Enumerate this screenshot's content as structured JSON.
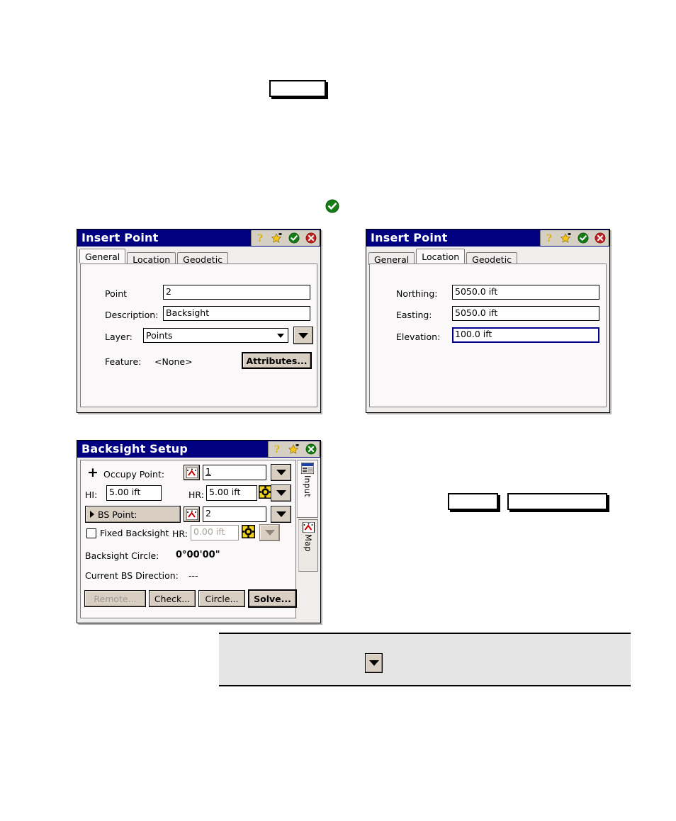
{
  "page": {
    "background": "#ffffff",
    "title_bar_color": "#000080",
    "button_face_color": "#d8cec2",
    "accent_green": "#1a8a1a",
    "accent_red": "#cc2020",
    "focus_blue": "#00008b"
  },
  "top_placeholder_box": {
    "name": "empty-outline-box",
    "label": ""
  },
  "standalone_check": {
    "name": "ok-check-icon",
    "color": "#1a8a1a"
  },
  "insert_point_general": {
    "title": "Insert Point",
    "title_icons": [
      "help-icon",
      "favorites-star-icon",
      "ok-check-icon",
      "close-x-icon"
    ],
    "tabs": [
      {
        "label": "General",
        "active": true
      },
      {
        "label": "Location",
        "active": false
      },
      {
        "label": "Geodetic",
        "active": false
      }
    ],
    "fields": [
      {
        "label": "Point",
        "value": "2"
      },
      {
        "label": "Description:",
        "value": "Backsight"
      }
    ],
    "layer": {
      "label": "Layer:",
      "value": "Points"
    },
    "feature": {
      "label": "Feature:",
      "value": "<None>"
    },
    "attributes_button": "Attributes..."
  },
  "insert_point_location": {
    "title": "Insert Point",
    "title_icons": [
      "help-icon",
      "favorites-star-icon",
      "ok-check-icon",
      "close-x-icon"
    ],
    "tabs": [
      {
        "label": "General",
        "active": false
      },
      {
        "label": "Location",
        "active": true
      },
      {
        "label": "Geodetic",
        "active": false
      }
    ],
    "fields": [
      {
        "label": "Northing:",
        "value": "5050.0 ift",
        "focused": false
      },
      {
        "label": "Easting:",
        "value": "5050.0 ift",
        "focused": false
      },
      {
        "label": "Elevation:",
        "value": "100.0 ift",
        "focused": true
      }
    ]
  },
  "backsight_setup": {
    "title": "Backsight Setup",
    "title_icons": [
      "help-icon",
      "favorites-star-icon",
      "close-green-x-icon"
    ],
    "occupy_point": {
      "label": "Occupy Point:",
      "value": "1",
      "icon": "point-pick-icon",
      "dropdown": "chevron-down-icon"
    },
    "hi": {
      "label": "HI:",
      "value": "5.00 ift"
    },
    "hr": {
      "label": "HR:",
      "value": "5.00 ift",
      "icon": "target-prism-icon",
      "dropdown": "chevron-down-icon"
    },
    "bs_point": {
      "label": "BS Point:",
      "value": "2",
      "icon": "point-pick-icon",
      "dropdown": "chevron-down-icon"
    },
    "fixed_backsight": {
      "label": "Fixed Backsight",
      "checked": false,
      "hr_label": "HR:",
      "hr_value": "0.00 ift",
      "disabled": true,
      "icon": "target-prism-icon",
      "dropdown": "chevron-down-icon"
    },
    "backsight_circle": {
      "label": "Backsight Circle:",
      "value": "0°00'00\""
    },
    "current_bs_direction": {
      "label": "Current BS Direction:",
      "value": "---"
    },
    "buttons": [
      {
        "label": "Remote...",
        "disabled": true,
        "default": false
      },
      {
        "label": "Check...",
        "disabled": false,
        "default": false
      },
      {
        "label": "Circle...",
        "disabled": false,
        "default": false
      },
      {
        "label": "Solve...",
        "disabled": false,
        "default": true
      }
    ],
    "side_tabs": [
      {
        "label": "Input",
        "icon": "input-form-icon",
        "active": true
      },
      {
        "label": "Map",
        "icon": "map-points-icon",
        "active": false
      }
    ]
  },
  "right_placeholder_boxes": [
    {
      "name": "empty-outline-box-small",
      "label": ""
    },
    {
      "name": "empty-outline-box-wide",
      "label": ""
    }
  ],
  "bottom_panel": {
    "name": "gray-note-panel",
    "background": "#e4e4e4",
    "dropdown_icon": "chevron-down-icon"
  }
}
